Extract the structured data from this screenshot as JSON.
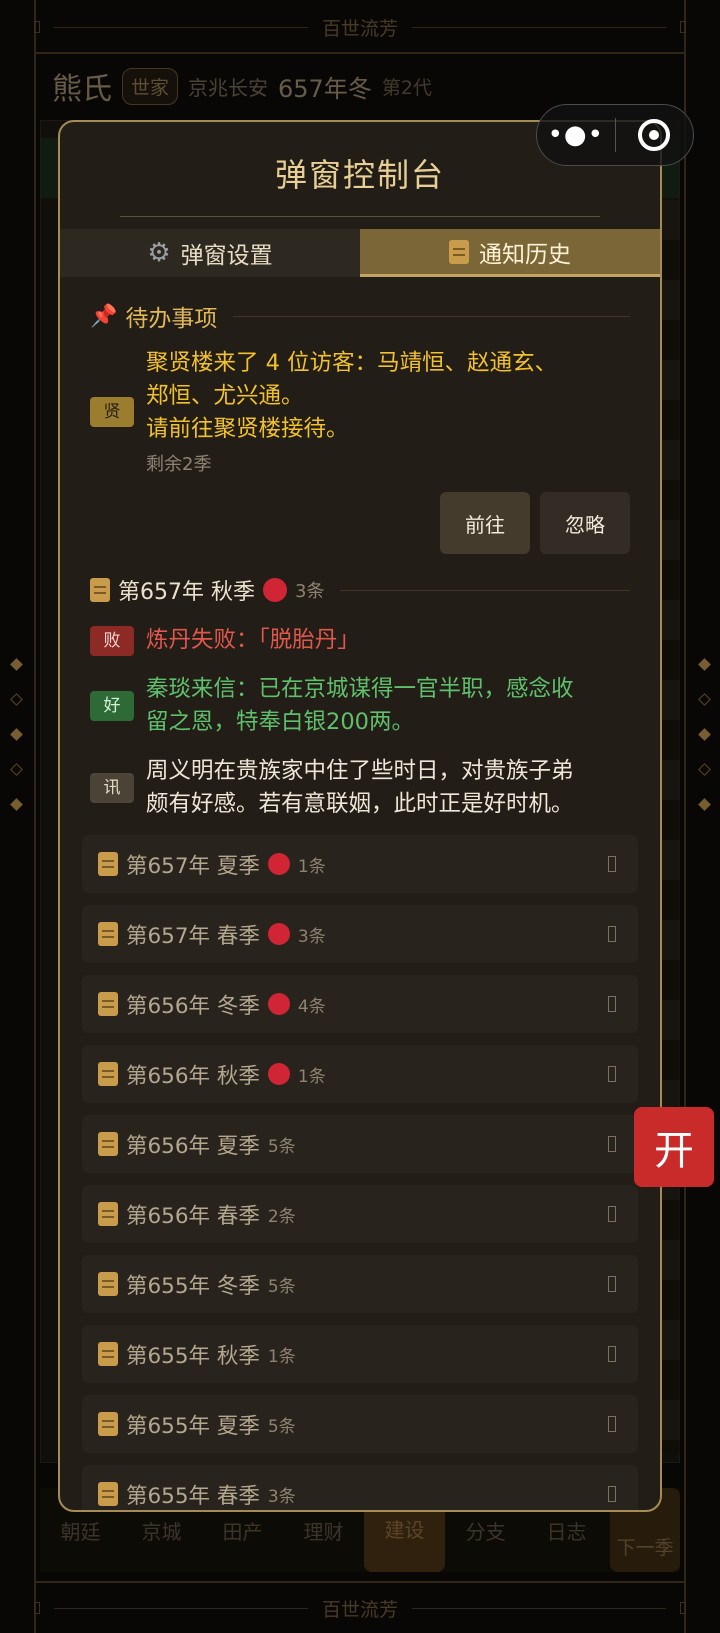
{
  "banner": {
    "title": "百世流芳"
  },
  "header": {
    "family_name": "熊氏",
    "rank": "世家",
    "location": "京兆长安",
    "year": "657年冬",
    "generation": "第2代"
  },
  "modal": {
    "title": "弹窗控制台",
    "tabs": [
      {
        "label": "弹窗设置",
        "icon": "gear-icon",
        "active": false
      },
      {
        "label": "通知历史",
        "icon": "scroll-icon",
        "active": true
      }
    ],
    "todo": {
      "section_title": "待办事项",
      "tag": "贤",
      "text_line1": "聚贤楼来了 4 位访客：马靖恒、赵通玄、",
      "text_line2": "郑恒、尤兴通。",
      "text_line3": "请前往聚贤楼接待。",
      "remaining": "剩余2季",
      "go_label": "前往",
      "ignore_label": "忽略"
    },
    "current_season": {
      "title": "第657年 秋季",
      "count": "3条",
      "items": [
        {
          "tag": "败",
          "type": "fail",
          "text": "炼丹失败：「脱胎丹」"
        },
        {
          "tag": "好",
          "type": "good",
          "line1": "秦琰来信：已在京城谋得一官半职，感念收",
          "line2": "留之恩，特奉白银200两。"
        },
        {
          "tag": "讯",
          "type": "info",
          "line1": "周义明在贵族家中住了些时日，对贵族子弟",
          "line2": "颇有好感。若有意联姻，此时正是好时机。"
        }
      ]
    },
    "history": [
      {
        "title": "第657年 夏季",
        "unread": true,
        "count": "1条"
      },
      {
        "title": "第657年 春季",
        "unread": true,
        "count": "3条"
      },
      {
        "title": "第656年 冬季",
        "unread": true,
        "count": "4条"
      },
      {
        "title": "第656年 秋季",
        "unread": true,
        "count": "1条"
      },
      {
        "title": "第656年 夏季",
        "unread": false,
        "count": "5条"
      },
      {
        "title": "第656年 春季",
        "unread": false,
        "count": "2条"
      },
      {
        "title": "第655年 冬季",
        "unread": false,
        "count": "5条"
      },
      {
        "title": "第655年 秋季",
        "unread": false,
        "count": "1条"
      },
      {
        "title": "第655年 夏季",
        "unread": false,
        "count": "5条"
      },
      {
        "title": "第655年 春季",
        "unread": false,
        "count": "3条"
      }
    ]
  },
  "bottom_nav": {
    "items": [
      "朝廷",
      "京城",
      "田产",
      "理财",
      "建设",
      "分支",
      "日志"
    ],
    "active": "建设",
    "next_season": "下一季"
  },
  "float_button": {
    "label": "开"
  },
  "colors": {
    "accent_gold": "#a58b55",
    "unread_dot": "#d02535",
    "open_button": "#c92b2b"
  }
}
